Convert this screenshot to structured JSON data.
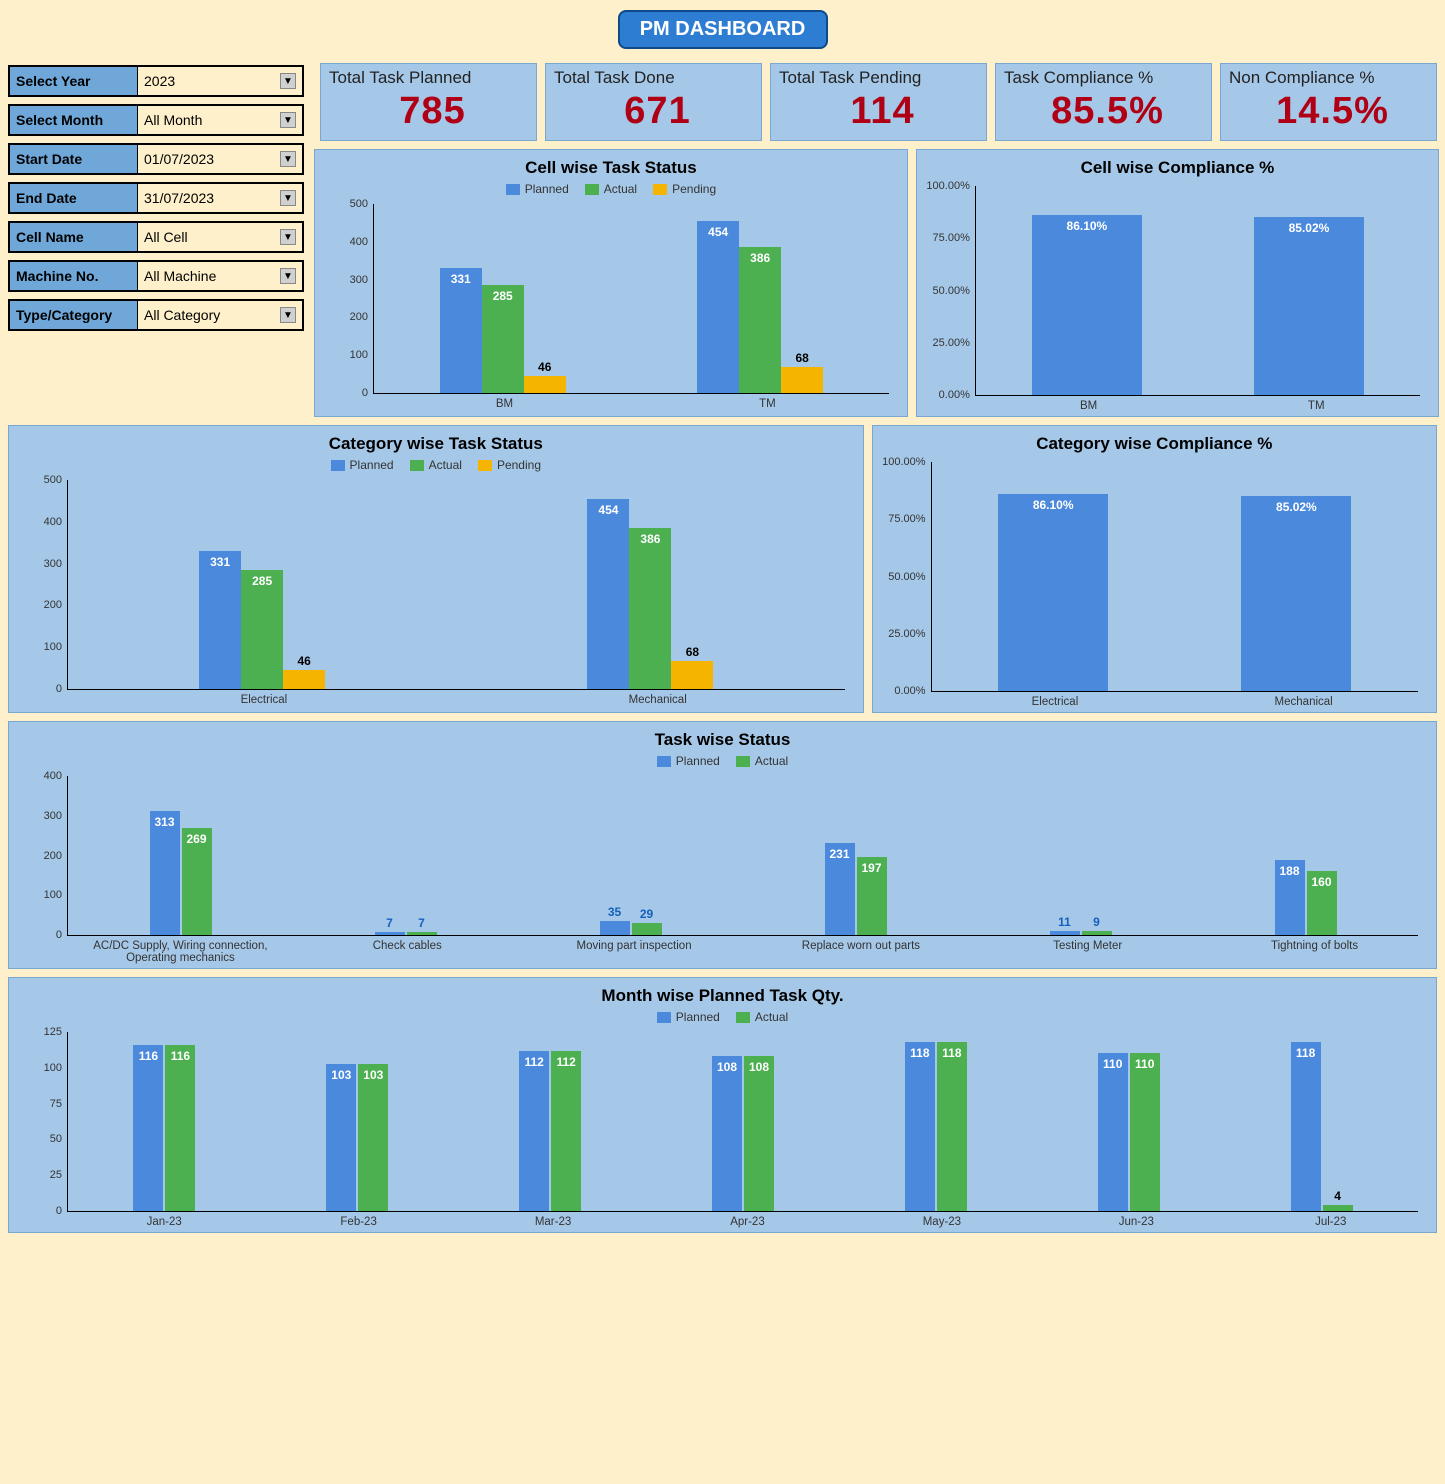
{
  "title": "PM DASHBOARD",
  "filters": {
    "year": {
      "label": "Select Year",
      "value": "2023"
    },
    "month": {
      "label": "Select Month",
      "value": "All Month"
    },
    "start": {
      "label": "Start Date",
      "value": "01/07/2023"
    },
    "end": {
      "label": "End Date",
      "value": "31/07/2023"
    },
    "cell": {
      "label": "Cell Name",
      "value": "All Cell"
    },
    "machine": {
      "label": "Machine No.",
      "value": "All Machine"
    },
    "category": {
      "label": "Type/Category",
      "value": "All Category"
    }
  },
  "kpis": {
    "planned": {
      "label": "Total Task Planned",
      "value": "785"
    },
    "done": {
      "label": "Total Task Done",
      "value": "671"
    },
    "pending": {
      "label": "Total Task Pending",
      "value": "114"
    },
    "compliance": {
      "label": "Task Compliance %",
      "value": "85.5%"
    },
    "noncomp": {
      "label": "Non Compliance %",
      "value": "14.5%"
    }
  },
  "legend": {
    "planned": "Planned",
    "actual": "Actual",
    "pending": "Pending"
  },
  "charts": {
    "cell_status": "Cell wise Task Status",
    "cell_comp": "Cell wise Compliance %",
    "cat_status": "Category wise Task Status",
    "cat_comp": "Category wise Compliance %",
    "task": "Task  wise Status",
    "month": "Month wise Planned Task Qty."
  },
  "chart_data": [
    {
      "id": "cell_status",
      "type": "bar",
      "title": "Cell wise Task Status",
      "categories": [
        "BM",
        "TM"
      ],
      "ylim": [
        0,
        500
      ],
      "yticks": [
        0,
        100,
        200,
        300,
        400,
        500
      ],
      "series": [
        {
          "name": "Planned",
          "values": [
            331,
            454
          ]
        },
        {
          "name": "Actual",
          "values": [
            285,
            386
          ]
        },
        {
          "name": "Pending",
          "values": [
            46,
            68
          ]
        }
      ]
    },
    {
      "id": "cell_comp",
      "type": "bar",
      "title": "Cell wise Compliance %",
      "categories": [
        "BM",
        "TM"
      ],
      "ylim": [
        0,
        100
      ],
      "yticks": [
        0,
        25,
        50,
        75,
        100
      ],
      "ytick_suffix": ".00%",
      "series": [
        {
          "name": "Compliance",
          "values": [
            86.1,
            85.02
          ]
        }
      ],
      "value_labels": [
        "86.10%",
        "85.02%"
      ]
    },
    {
      "id": "cat_status",
      "type": "bar",
      "title": "Category wise Task Status",
      "categories": [
        "Electrical",
        "Mechanical"
      ],
      "ylim": [
        0,
        500
      ],
      "yticks": [
        0,
        100,
        200,
        300,
        400,
        500
      ],
      "series": [
        {
          "name": "Planned",
          "values": [
            331,
            454
          ]
        },
        {
          "name": "Actual",
          "values": [
            285,
            386
          ]
        },
        {
          "name": "Pending",
          "values": [
            46,
            68
          ]
        }
      ]
    },
    {
      "id": "cat_comp",
      "type": "bar",
      "title": "Category wise Compliance %",
      "categories": [
        "Electrical",
        "Mechanical"
      ],
      "ylim": [
        0,
        100
      ],
      "yticks": [
        0,
        25,
        50,
        75,
        100
      ],
      "ytick_suffix": ".00%",
      "series": [
        {
          "name": "Compliance",
          "values": [
            86.1,
            85.02
          ]
        }
      ],
      "value_labels": [
        "86.10%",
        "85.02%"
      ]
    },
    {
      "id": "task",
      "type": "bar",
      "title": "Task  wise Status",
      "categories": [
        "AC/DC Supply, Wiring connection, Operating mechanics",
        "Check cables",
        "Moving part inspection",
        "Replace worn out parts",
        "Testing Meter",
        "Tightning of bolts"
      ],
      "ylim": [
        0,
        400
      ],
      "yticks": [
        0,
        100,
        200,
        300,
        400
      ],
      "series": [
        {
          "name": "Planned",
          "values": [
            313,
            7,
            35,
            231,
            11,
            188
          ]
        },
        {
          "name": "Actual",
          "values": [
            269,
            7,
            29,
            197,
            9,
            160
          ]
        }
      ]
    },
    {
      "id": "month",
      "type": "bar",
      "title": "Month wise Planned Task Qty.",
      "categories": [
        "Jan-23",
        "Feb-23",
        "Mar-23",
        "Apr-23",
        "May-23",
        "Jun-23",
        "Jul-23"
      ],
      "ylim": [
        0,
        125
      ],
      "yticks": [
        0,
        25,
        50,
        75,
        100,
        125
      ],
      "series": [
        {
          "name": "Planned",
          "values": [
            116,
            103,
            112,
            108,
            118,
            110,
            118
          ]
        },
        {
          "name": "Actual",
          "values": [
            116,
            103,
            112,
            108,
            118,
            110,
            4
          ]
        }
      ]
    }
  ]
}
